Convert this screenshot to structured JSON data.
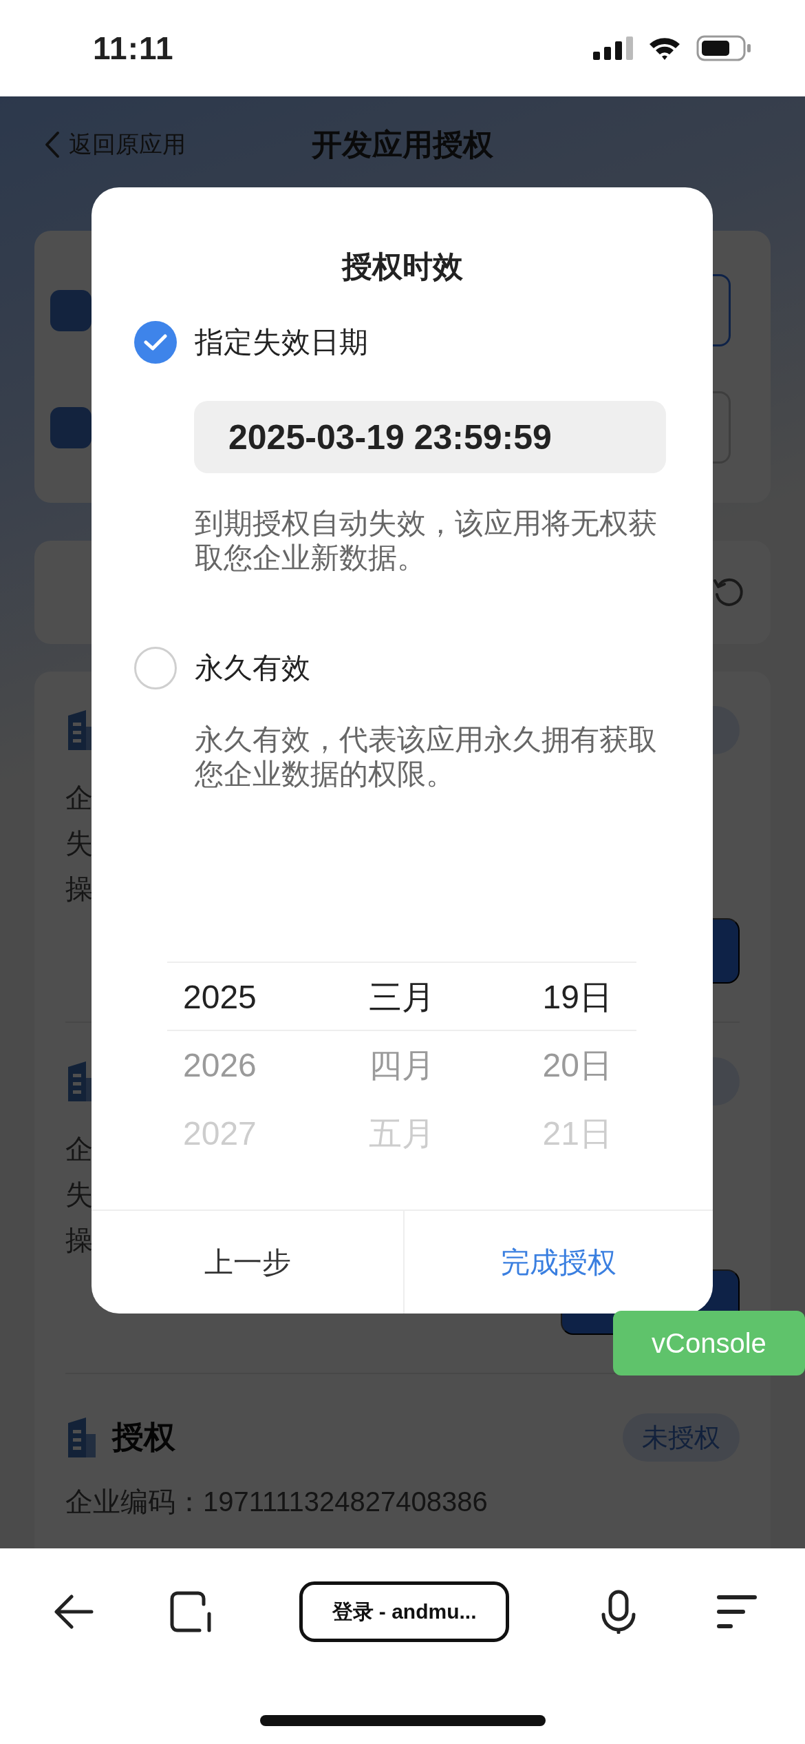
{
  "status_bar": {
    "time": "11:11"
  },
  "nav": {
    "back_label": "返回原应用",
    "title": "开发应用授权"
  },
  "list": {
    "items": [
      {
        "kind": "covered",
        "lines": [
          "企",
          "失",
          "操"
        ]
      },
      {
        "kind": "covered",
        "lines": [
          "企",
          "失",
          "操"
        ]
      },
      {
        "kind": "full",
        "title": "授权",
        "badge": "未授权",
        "lines": [
          "企业编码：1971111324827408386"
        ]
      }
    ]
  },
  "dialog": {
    "title": "授权时效",
    "options": [
      {
        "label": "指定失效日期",
        "selected": true,
        "value": "2025-03-19 23:59:59",
        "description": "到期授权自动失效，该应用将无权获取您企业新数据。"
      },
      {
        "label": "永久有效",
        "selected": false,
        "description": "永久有效，代表该应用永久拥有获取您企业数据的权限。"
      }
    ],
    "picker": [
      {
        "items": [
          {
            "label": "2025",
            "selected": true
          },
          {
            "label": "2026",
            "selected": false
          },
          {
            "label": "2027",
            "selected": false
          }
        ]
      },
      {
        "items": [
          {
            "label": "三月",
            "selected": true
          },
          {
            "label": "四月",
            "selected": false
          },
          {
            "label": "五月",
            "selected": false
          }
        ]
      },
      {
        "items": [
          {
            "label": "19日",
            "selected": true
          },
          {
            "label": "20日",
            "selected": false
          },
          {
            "label": "21日",
            "selected": false
          }
        ]
      }
    ],
    "buttons": [
      {
        "label": "上一步",
        "kind": "secondary"
      },
      {
        "label": "完成授权",
        "kind": "primary"
      }
    ]
  },
  "vconsole": {
    "label": "vConsole"
  },
  "browser": {
    "url": "登录 - andmu..."
  }
}
